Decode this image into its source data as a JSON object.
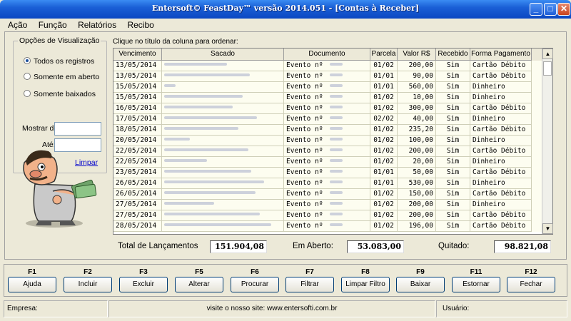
{
  "window": {
    "title": "Entersoft© FeastDay™ versão 2014.051 - [Contas à Receber]"
  },
  "menu": [
    "Ação",
    "Função",
    "Relatórios",
    "Recibo"
  ],
  "filter": {
    "legend": "Opções de Visualização",
    "options": [
      "Todos os registros",
      "Somente em aberto",
      "Somente baixados"
    ],
    "selected": 0,
    "from_label": "Mostrar de",
    "to_label": "Até:",
    "clear_link": "Limpar"
  },
  "grid": {
    "hint": "Clique no título da coluna para ordenar:",
    "columns": [
      "Vencimento",
      "Sacado",
      "Documento",
      "Parcela",
      "Valor R$",
      "Recebido",
      "Forma Pagamento"
    ],
    "rows": [
      {
        "venc": "13/05/2014",
        "doc": "Evento nº",
        "parc": "01/02",
        "valor": "200,00",
        "rec": "Sim",
        "forma": "Cartão Débito"
      },
      {
        "venc": "13/05/2014",
        "doc": "Evento nº",
        "parc": "01/01",
        "valor": "90,00",
        "rec": "Sim",
        "forma": "Cartão Débito"
      },
      {
        "venc": "15/05/2014",
        "doc": "Evento nº",
        "parc": "01/01",
        "valor": "560,00",
        "rec": "Sim",
        "forma": "Dinheiro"
      },
      {
        "venc": "15/05/2014",
        "doc": "Evento nº",
        "parc": "01/02",
        "valor": "10,00",
        "rec": "Sim",
        "forma": "Dinheiro"
      },
      {
        "venc": "16/05/2014",
        "doc": "Evento nº",
        "parc": "01/02",
        "valor": "300,00",
        "rec": "Sim",
        "forma": "Cartão Débito"
      },
      {
        "venc": "17/05/2014",
        "doc": "Evento nº",
        "parc": "02/02",
        "valor": "40,00",
        "rec": "Sim",
        "forma": "Dinheiro"
      },
      {
        "venc": "18/05/2014",
        "doc": "Evento nº",
        "parc": "01/02",
        "valor": "235,20",
        "rec": "Sim",
        "forma": "Cartão Débito"
      },
      {
        "venc": "20/05/2014",
        "doc": "Evento nº",
        "parc": "01/02",
        "valor": "100,00",
        "rec": "Sim",
        "forma": "Dinheiro"
      },
      {
        "venc": "22/05/2014",
        "doc": "Evento nº",
        "parc": "01/02",
        "valor": "200,00",
        "rec": "Sim",
        "forma": "Cartão Débito"
      },
      {
        "venc": "22/05/2014",
        "doc": "Evento nº",
        "parc": "01/02",
        "valor": "20,00",
        "rec": "Sim",
        "forma": "Dinheiro"
      },
      {
        "venc": "23/05/2014",
        "doc": "Evento nº",
        "parc": "01/01",
        "valor": "50,00",
        "rec": "Sim",
        "forma": "Cartão Débito"
      },
      {
        "venc": "26/05/2014",
        "doc": "Evento nº",
        "parc": "01/01",
        "valor": "530,00",
        "rec": "Sim",
        "forma": "Dinheiro"
      },
      {
        "venc": "26/05/2014",
        "doc": "Evento nº",
        "parc": "01/02",
        "valor": "150,00",
        "rec": "Sim",
        "forma": "Cartão Débito"
      },
      {
        "venc": "27/05/2014",
        "doc": "Evento nº",
        "parc": "01/02",
        "valor": "200,00",
        "rec": "Sim",
        "forma": "Dinheiro"
      },
      {
        "venc": "27/05/2014",
        "doc": "Evento nº",
        "parc": "01/02",
        "valor": "200,00",
        "rec": "Sim",
        "forma": "Cartão Débito"
      },
      {
        "venc": "28/05/2014",
        "doc": "Evento nº",
        "parc": "01/02",
        "valor": "196,00",
        "rec": "Sim",
        "forma": "Cartão Débito"
      }
    ]
  },
  "totals": {
    "total_label": "Total de Lançamentos",
    "total_value": "151.904,08",
    "open_label": "Em Aberto:",
    "open_value": "53.083,00",
    "paid_label": "Quitado:",
    "paid_value": "98.821,08"
  },
  "buttons": [
    {
      "key": "F1",
      "label": "Ajuda"
    },
    {
      "key": "F2",
      "label": "Incluir"
    },
    {
      "key": "F3",
      "label": "Excluir"
    },
    {
      "key": "F5",
      "label": "Alterar"
    },
    {
      "key": "F6",
      "label": "Procurar"
    },
    {
      "key": "F7",
      "label": "Filtrar"
    },
    {
      "key": "F8",
      "label": "Limpar Filtro"
    },
    {
      "key": "F9",
      "label": "Baixar"
    },
    {
      "key": "F11",
      "label": "Estornar"
    },
    {
      "key": "F12",
      "label": "Fechar"
    }
  ],
  "status": {
    "company": "Empresa:",
    "site": "visite o nosso site: www.entersofti.com.br",
    "user": "Usuário:"
  },
  "colors": {
    "titlebar": "#0b47c2",
    "row_bg": "#fdfdf0",
    "link": "#0000cc"
  }
}
